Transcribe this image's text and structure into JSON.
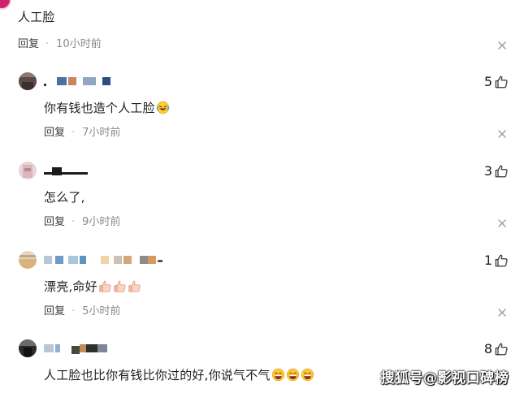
{
  "top_comment": {
    "text": "人工脸",
    "reply_label": "回复",
    "time": "10小时前"
  },
  "replies": [
    {
      "like_count": "5",
      "text": "你有钱也造个人工脸",
      "emoji_icons": [
        "laughing-crying-emoji-icon"
      ],
      "reply_label": "回复",
      "time": "7小时前"
    },
    {
      "like_count": "3",
      "text": "怎么了,",
      "emoji_icons": [],
      "reply_label": "回复",
      "time": "9小时前"
    },
    {
      "like_count": "1",
      "text": "漂亮,命好",
      "emoji_icons": [
        "thumbs-up-emoji-icon",
        "thumbs-up-emoji-icon",
        "thumbs-up-emoji-icon"
      ],
      "reply_label": "回复",
      "time": "5小时前"
    },
    {
      "like_count": "8",
      "text": "人工脸也比你有钱比你过的好,你说气不气",
      "emoji_icons": [
        "grinning-emoji-icon",
        "grinning-emoji-icon",
        "grinning-emoji-icon"
      ],
      "reply_label": "",
      "time": ""
    }
  ],
  "watermark": "搜狐号@影视口碑榜",
  "colors": {
    "text": "#1f1f1f",
    "meta": "#8a8a8a",
    "icon": "#333333"
  }
}
